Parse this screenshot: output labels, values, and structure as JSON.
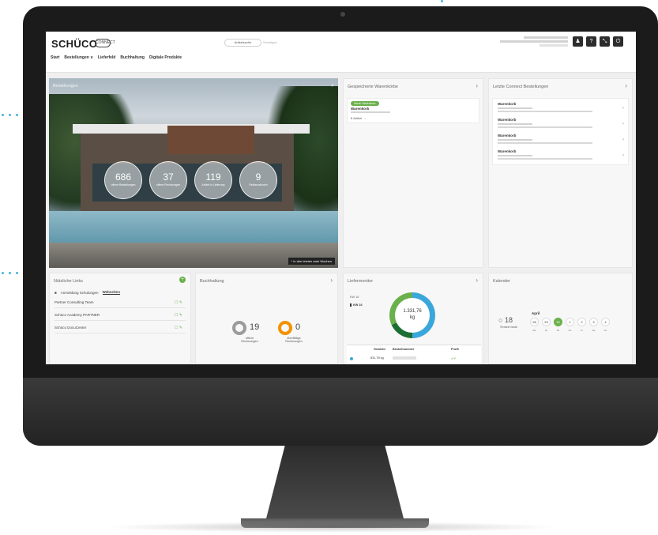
{
  "app": {
    "logo": "SCHÜCO",
    "logo_sub": "CONNECT",
    "search_tabs": [
      "Artikelsuche",
      "Sonstiges"
    ],
    "toolbar_buttons": [
      {
        "icon": "user-icon",
        "glyph": "♟"
      },
      {
        "icon": "help-icon",
        "glyph": "?"
      },
      {
        "icon": "expand-icon",
        "glyph": "⤡"
      },
      {
        "icon": "power-icon",
        "glyph": "⏻"
      }
    ],
    "nav": [
      "Start",
      "Bestellungen ∨",
      "Lieferfeld",
      "Buchhaltung",
      "Digitale Produkte"
    ]
  },
  "hero": {
    "title": "Bestellungen",
    "stats": [
      {
        "value": "686",
        "label": "offene Bestellungen"
      },
      {
        "value": "37",
        "label": "offene Rechnungen"
      },
      {
        "value": "119",
        "label": "Artikel in Lieferung"
      },
      {
        "value": "9",
        "label": "Reklamationen"
      }
    ],
    "note": "* in den letzten zwei Wochen"
  },
  "warenkoerbe": {
    "title": "Gespeicherte Warenkörbe",
    "item": {
      "badge": "Neuer Warenkorb",
      "name": "Warenkorb",
      "meta": "8 Artikel →"
    }
  },
  "bestellungen": {
    "title": "Letzte Connect Bestellungen",
    "rows": [
      "Warenkorb",
      "Warenkorb",
      "Warenkorb",
      "Warenkorb"
    ]
  },
  "links": {
    "title": "Nützliche Links",
    "tabs": [
      "Anmeldung Schulungen",
      "Webseiten"
    ],
    "rows": [
      "Partner Consulting Team",
      "Schüco Academy PARTNER",
      "Schüco DocuCenter"
    ]
  },
  "buchhaltung": {
    "title": "Buchhaltung",
    "items": [
      {
        "value": "19",
        "label": "offene Rechnungen",
        "color": "#9b9b9b"
      },
      {
        "value": "0",
        "label": "überfällige Rechnungen",
        "color": "#f39200"
      }
    ]
  },
  "liefermonitor": {
    "title": "Liefermonitor",
    "left_top": "KW 16",
    "left_sel": "KW 16",
    "donut_value": "1.331,76",
    "donut_unit": "kg",
    "table_headers": [
      "Gewicht",
      "Bestellnummer",
      "Profil"
    ],
    "table_row_weight": "831,78 kg"
  },
  "kalender": {
    "title": "Kalender",
    "count": "18",
    "count_label": "Termine heute",
    "month": "April",
    "days": [
      "28",
      "29",
      "30",
      "1",
      "2",
      "3",
      "4"
    ],
    "today_index": 2,
    "weekdays": [
      "Mo",
      "Di",
      "Mi",
      "Do",
      "Fr",
      "Sa",
      "So"
    ]
  },
  "colors": {
    "accent_green": "#6ab04c",
    "accent_blue": "#3aa7db",
    "accent_orange": "#f39200"
  }
}
